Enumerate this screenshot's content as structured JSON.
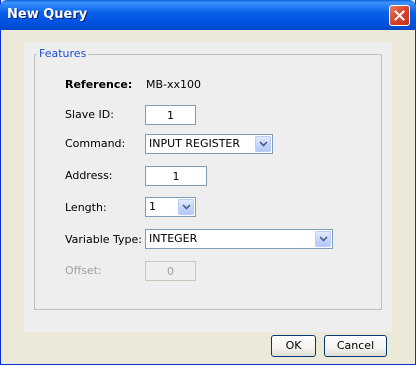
{
  "window": {
    "title": "New Query"
  },
  "features": {
    "legend": "Features",
    "reference_label": "Reference:",
    "reference_value": "MB-xx100",
    "slave_id_label": "Slave ID:",
    "slave_id_value": "1",
    "command_label": "Command:",
    "command_value": "INPUT REGISTER",
    "address_label": "Address:",
    "address_value": "1",
    "length_label": "Length:",
    "length_value": "1",
    "variable_type_label": "Variable Type:",
    "variable_type_value": "INTEGER",
    "offset_label": "Offset:",
    "offset_value": "0"
  },
  "buttons": {
    "ok": "OK",
    "cancel": "Cancel"
  },
  "icons": {
    "close": "close-icon",
    "dropdown": "chevron-down-icon"
  },
  "colors": {
    "title_bar": "#0054e3",
    "legend_text": "#1f4fd0",
    "dialog_bg": "#ece9d8",
    "close_button": "#d5452b"
  }
}
